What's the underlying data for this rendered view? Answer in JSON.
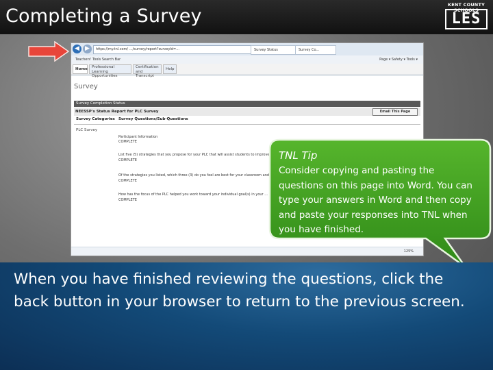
{
  "slide": {
    "title": "Completing a Survey",
    "logo": {
      "top_text": "KENT COUNTY SCHOOLS",
      "letters": "LES"
    }
  },
  "browser": {
    "url": "https://my.tnl.com/  .../survey/report?surveyId=...",
    "tabs": [
      "Survey Status",
      "Survey Co..."
    ],
    "favorites": "Teachers' Tools    Search Bar",
    "toolbar_right": "Page ▾  Safety ▾  Tools ▾",
    "app_tabs": [
      {
        "label": "Home"
      },
      {
        "label": "Professional Learning Opportunities"
      },
      {
        "label": "Certification and Transcript"
      },
      {
        "label": "Help"
      }
    ],
    "page_heading": "Survey",
    "status_bar": "Survey Completion Status",
    "report_title": "NEESSP's Status Report for PLC Survey",
    "email_button": "Email This Page",
    "columns": [
      "Survey Categories",
      "Survey Questions/Sub-Questions"
    ],
    "category": "PLC Survey",
    "questions": [
      {
        "text": "Participant Information",
        "status": "COMPLETE"
      },
      {
        "text": "List five (5) strategies that you propose for your PLC that will assist students to improve ...",
        "status": "COMPLETE"
      },
      {
        "text": "Of the strategies you listed, which three (3) do you feel are best for your classroom and school ...",
        "status": "COMPLETE"
      },
      {
        "text": "How has the focus of the PLC helped you work toward your individual goal(s) in your ...",
        "status": "COMPLETE"
      }
    ],
    "zoom": "125%"
  },
  "tip": {
    "title": "TNL Tip",
    "body": "Consider copying and pasting the questions on this page into Word. You can type your answers in Word and then copy and paste your responses into TNL when you have finished."
  },
  "instruction": "When you have finished reviewing the questions, click the back button in your browser to return to the previous screen.",
  "colors": {
    "tip_green": "#3f9a1f",
    "panel_blue": "#134a78",
    "arrow_red": "#e8453a",
    "title_bar": "#1a1a1a"
  }
}
